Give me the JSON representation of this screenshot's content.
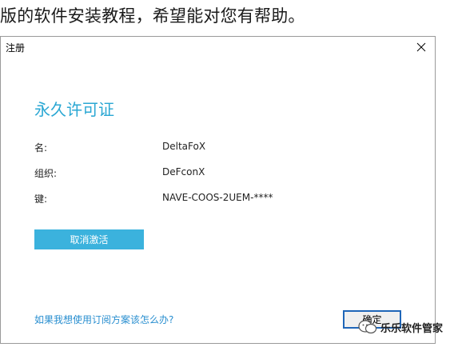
{
  "article": {
    "caption": "版的软件安装教程，希望能对您有帮助。"
  },
  "dialog": {
    "title": "注册",
    "heading": "永久许可证",
    "fields": [
      {
        "label": "名:",
        "value": "DeltaFoX"
      },
      {
        "label": "组织:",
        "value": "DeFconX"
      },
      {
        "label": "键:",
        "value": "NAVE-COOS-2UEM-****"
      }
    ],
    "deactivate_label": "取消激活",
    "help_link": "如果我想使用订阅方案该怎么办?",
    "ok_label": "确定"
  },
  "watermark": {
    "text": "乐乐软件管家"
  },
  "colors": {
    "accent": "#2aa7d3",
    "button_fill": "#3bb2dd",
    "link": "#2a8fd0",
    "focus_border": "#1f66b8"
  }
}
